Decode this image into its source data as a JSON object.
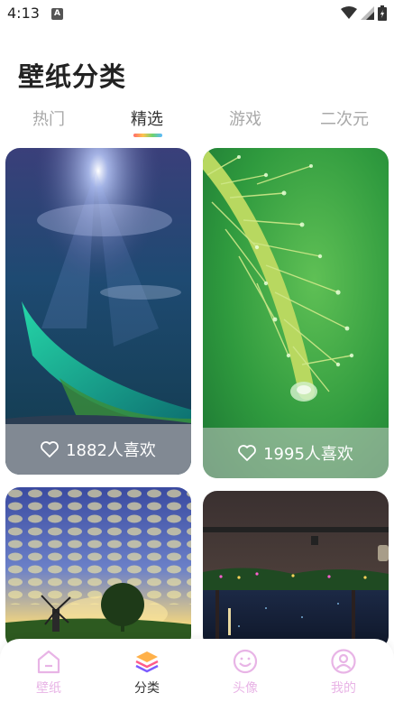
{
  "status_bar": {
    "time": "4:13",
    "notif_letter": "A"
  },
  "page": {
    "title": "壁纸分类"
  },
  "tabs": [
    {
      "label": "热门"
    },
    {
      "label": "精选"
    },
    {
      "label": "游戏"
    },
    {
      "label": "二次元"
    }
  ],
  "cards": [
    {
      "likes": "1882人喜欢",
      "subject": "ocean-moon-night"
    },
    {
      "likes": "1995人喜欢",
      "subject": "green-grass-dewdrops"
    },
    {
      "subject": "cloud-sky-windmill"
    },
    {
      "subject": "night-window-view"
    }
  ],
  "nav": {
    "items": [
      {
        "label": "壁纸",
        "icon": "home-icon"
      },
      {
        "label": "分类",
        "icon": "layers-icon"
      },
      {
        "label": "头像",
        "icon": "smile-icon"
      },
      {
        "label": "我的",
        "icon": "user-icon"
      }
    ]
  },
  "colors": {
    "nav_inactive": "#e8b4e6",
    "nav_active": "#333333",
    "tab_inactive": "#a8a8a8"
  }
}
